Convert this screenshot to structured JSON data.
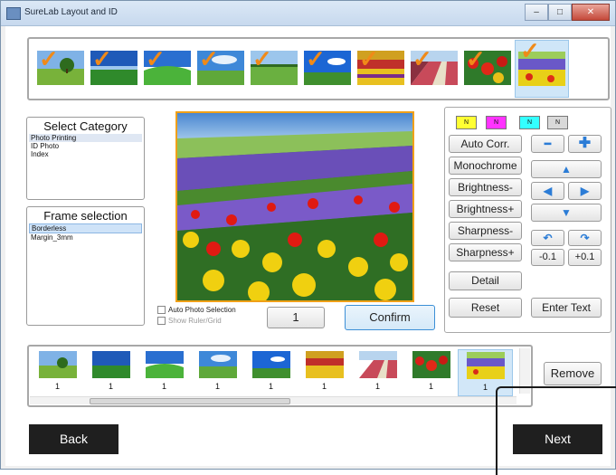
{
  "window": {
    "title": "SureLab Layout and ID",
    "controls": [
      "–",
      "□",
      "✕"
    ]
  },
  "top_strip": {
    "thumbnails": [
      {
        "scene": "tree-field",
        "checked": true,
        "selected": false
      },
      {
        "scene": "blue-field",
        "checked": true,
        "selected": false
      },
      {
        "scene": "green-hill",
        "checked": true,
        "selected": false
      },
      {
        "scene": "sky-meadow",
        "checked": true,
        "selected": false
      },
      {
        "scene": "grass-plain",
        "checked": true,
        "selected": false
      },
      {
        "scene": "blue-sky-field",
        "checked": true,
        "selected": false
      },
      {
        "scene": "flower-field",
        "checked": true,
        "selected": false
      },
      {
        "scene": "red-rows",
        "checked": true,
        "selected": false
      },
      {
        "scene": "red-tulips",
        "checked": true,
        "selected": false
      },
      {
        "scene": "lavender",
        "checked": true,
        "selected": true
      }
    ]
  },
  "category": {
    "title": "Select Category",
    "items": [
      "Photo Printing",
      "ID Photo",
      "Index"
    ],
    "selected_index": 0
  },
  "frame": {
    "title": "Frame selection",
    "items": [
      "Borderless",
      "Margin_3mm"
    ],
    "selected_index": 0
  },
  "options": {
    "auto_photo_selection": "Auto Photo Selection",
    "show_ruler_grid": "Show Ruler/Grid"
  },
  "quantity": {
    "value": "1"
  },
  "confirm_label": "Confirm",
  "tools": {
    "n_boxes": [
      {
        "label": "N",
        "color": "#ffff33"
      },
      {
        "label": "N",
        "color": "#ff33ff"
      },
      {
        "label": "N",
        "color": "#33ffff"
      },
      {
        "label": "N",
        "color": "#d9d9d9"
      }
    ],
    "buttons": {
      "auto_corr": "Auto Corr.",
      "monochrome": "Monochrome",
      "brightness_minus": "Brightness-",
      "brightness_plus": "Brightness+",
      "sharpness_minus": "Sharpness-",
      "sharpness_plus": "Sharpness+",
      "detail": "Detail",
      "reset": "Reset",
      "enter_text": "Enter Text",
      "minus_01": "-0.1",
      "plus_01": "+0.1"
    }
  },
  "bottom_strip": {
    "items": [
      {
        "scene": "tree-field",
        "count": "1",
        "selected": false
      },
      {
        "scene": "blue-field",
        "count": "1",
        "selected": false
      },
      {
        "scene": "green-hill",
        "count": "1",
        "selected": false
      },
      {
        "scene": "sky-meadow",
        "count": "1",
        "selected": false
      },
      {
        "scene": "blue-sky-field",
        "count": "1",
        "selected": false
      },
      {
        "scene": "flower-field",
        "count": "1",
        "selected": false
      },
      {
        "scene": "red-rows",
        "count": "1",
        "selected": false
      },
      {
        "scene": "red-tulips",
        "count": "1",
        "selected": false
      },
      {
        "scene": "lavender",
        "count": "1",
        "selected": true
      }
    ]
  },
  "remove_label": "Remove",
  "back_label": "Back",
  "next_label": "Next",
  "colors": {
    "accent": "#f0a018",
    "confirm_border": "#3c8fd6",
    "check": "#f08a18"
  }
}
